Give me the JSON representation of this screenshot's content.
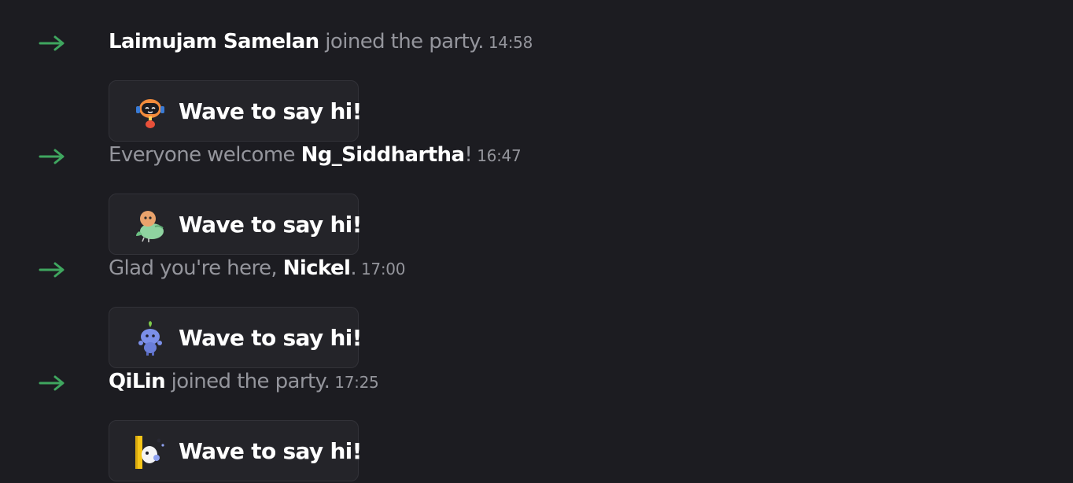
{
  "colors": {
    "background": "#1c1c21",
    "arrow": "#3fa65f",
    "muted_text": "#94959c",
    "name_text": "#ffffff",
    "button_bg": "#242429"
  },
  "messages": [
    {
      "user": "Laimujam Samelan",
      "pre": "",
      "post": " joined the party.",
      "time": "14:58",
      "button_label": "Wave to say hi!",
      "sticker_icon": "orange-headphone-robot-sticker-icon"
    },
    {
      "user": "Ng_Siddhartha",
      "pre": "Everyone welcome ",
      "post": "!",
      "time": "16:47",
      "button_label": "Wave to say hi!",
      "sticker_icon": "green-bird-sticker-icon"
    },
    {
      "user": "Nickel",
      "pre": "Glad you're here, ",
      "post": ".",
      "time": "17:00",
      "button_label": "Wave to say hi!",
      "sticker_icon": "blue-wumpus-sprout-sticker-icon"
    },
    {
      "user": "QiLin",
      "pre": "",
      "post": " joined the party.",
      "time": "17:25",
      "button_label": "Wave to say hi!",
      "sticker_icon": "peeking-ghost-sticker-icon"
    }
  ]
}
